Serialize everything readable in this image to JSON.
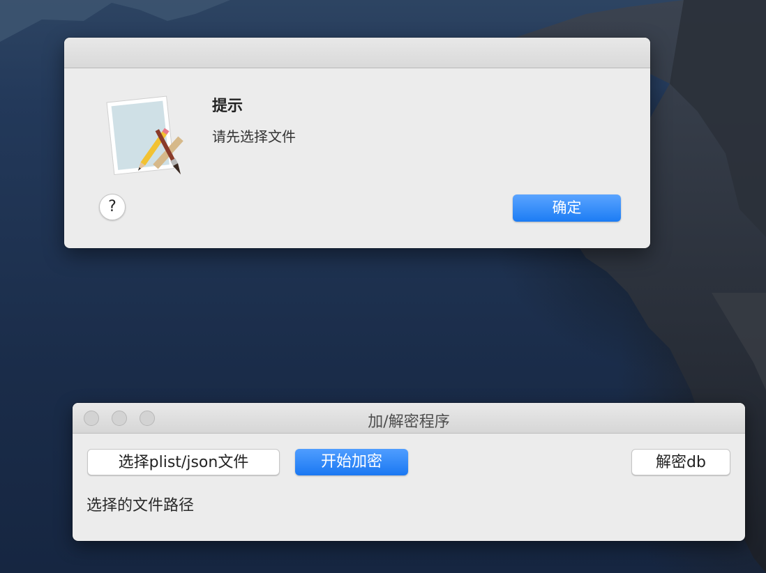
{
  "alert": {
    "title": "提示",
    "message": "请先选择文件",
    "help_label": "?",
    "ok_label": "确定",
    "icon": "xcode-app-icon"
  },
  "main_window": {
    "title": "加/解密程序",
    "buttons": {
      "select_file": "选择plist/json文件",
      "start_encrypt": "开始加密",
      "decrypt_db": "解密db"
    },
    "path_label": "选择的文件路径"
  },
  "colors": {
    "accent_blue": "#1c7cf4",
    "window_bg": "#ececec"
  }
}
